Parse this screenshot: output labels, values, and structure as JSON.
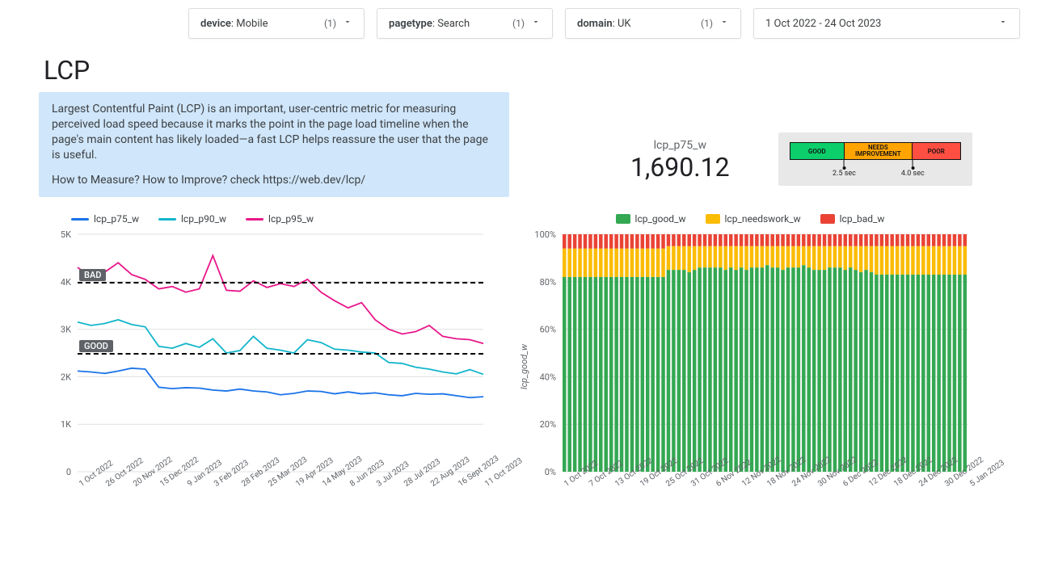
{
  "filters": [
    {
      "name": "device",
      "value": "Mobile",
      "count": "(1)"
    },
    {
      "name": "pagetype",
      "value": "Search",
      "count": "(1)"
    },
    {
      "name": "domain",
      "value": "UK",
      "count": "(1)"
    }
  ],
  "date_range": "1 Oct 2022 - 24 Oct 2023",
  "title": "LCP",
  "description": {
    "p1": "Largest Contentful Paint (LCP) is an important, user-centric metric for measuring perceived load speed because it marks the point in the page load timeline when the page's main content has likely loaded—a fast LCP helps reassure the user that the page is useful.",
    "p2": "How to Measure? How to Improve? check https://web.dev/lcp/"
  },
  "scorecard": {
    "label": "lcp_p75_w",
    "value": "1,690.12"
  },
  "thresholds": {
    "good": "GOOD",
    "ni": "NEEDS IMPROVEMENT",
    "poor": "POOR",
    "m1": "2.5 sec",
    "m2": "4.0 sec"
  },
  "chart_data": [
    {
      "id": "percentile_lines",
      "type": "line",
      "title": "",
      "ylabel": "",
      "ylim": [
        0,
        5000
      ],
      "yticks": [
        "0",
        "1K",
        "2K",
        "3K",
        "4K",
        "5K"
      ],
      "categories": [
        "1 Oct 2022",
        "26 Oct 2022",
        "20 Nov 2022",
        "15 Dec 2022",
        "9 Jan 2023",
        "3 Feb 2023",
        "28 Feb 2023",
        "25 Mar 2023",
        "19 Apr 2023",
        "14 May 2023",
        "8 Jun 2023",
        "3 Jul 2023",
        "28 Jul 2023",
        "22 Aug 2023",
        "16 Sept 2023",
        "11 Oct 2023"
      ],
      "annotations": {
        "bad_line": 4000,
        "good_line": 2500,
        "bad_label": "BAD",
        "good_label": "GOOD"
      },
      "series": [
        {
          "name": "lcp_p75_w",
          "color": "#1a73e8",
          "values": [
            2120,
            2100,
            2070,
            2120,
            2180,
            2160,
            1780,
            1750,
            1770,
            1760,
            1720,
            1700,
            1740,
            1700,
            1680,
            1620,
            1650,
            1700,
            1690,
            1640,
            1680,
            1640,
            1660,
            1620,
            1600,
            1650,
            1630,
            1640,
            1600,
            1560,
            1580
          ]
        },
        {
          "name": "lcp_p90_w",
          "color": "#12b5cb",
          "values": [
            3150,
            3080,
            3120,
            3200,
            3100,
            3050,
            2640,
            2600,
            2700,
            2620,
            2800,
            2500,
            2550,
            2850,
            2600,
            2560,
            2500,
            2780,
            2720,
            2580,
            2560,
            2520,
            2500,
            2300,
            2280,
            2200,
            2160,
            2100,
            2060,
            2150,
            2050
          ]
        },
        {
          "name": "lcp_p95_w",
          "color": "#e8178a",
          "values": [
            4300,
            4100,
            4200,
            4400,
            4150,
            4050,
            3850,
            3900,
            3780,
            3850,
            4550,
            3820,
            3800,
            4020,
            3880,
            3960,
            3900,
            4050,
            3780,
            3600,
            3450,
            3560,
            3200,
            3000,
            2900,
            2950,
            3080,
            2850,
            2800,
            2780,
            2700
          ]
        }
      ]
    },
    {
      "id": "stacked_pct",
      "type": "bar",
      "stacked": true,
      "ylabel": "lcp_good_w",
      "ylim": [
        0,
        100
      ],
      "yticks": [
        "0%",
        "20%",
        "40%",
        "60%",
        "80%",
        "100%"
      ],
      "categories": [
        "1 Oct 2022",
        "7 Oct 2022",
        "13 Oct 2022",
        "19 Oct 2022",
        "25 Oct 2022",
        "31 Oct 2022",
        "6 Nov 2022",
        "12 Nov 2022",
        "18 Nov 2022",
        "24 Nov 2022",
        "30 Nov 2022",
        "6 Dec 2022",
        "12 Dec 2022",
        "18 Dec 2022",
        "24 Dec 2022",
        "30 Dec 2022",
        "5 Jan 2023"
      ],
      "series": [
        {
          "name": "lcp_good_w",
          "color": "#34a853",
          "values": [
            82,
            82,
            82,
            82,
            82,
            82,
            82,
            82,
            82,
            82,
            82,
            82,
            82,
            82,
            82,
            82,
            82,
            82,
            82,
            82,
            85,
            85,
            85,
            85,
            84,
            85,
            86,
            86,
            86,
            86,
            86,
            85,
            86,
            85,
            86,
            85,
            86,
            86,
            86,
            87,
            86,
            86,
            85,
            86,
            86,
            86,
            87,
            86,
            85,
            85,
            85,
            86,
            86,
            86,
            85,
            86,
            85,
            84,
            85,
            84,
            83,
            83,
            83,
            83,
            83,
            83,
            83,
            83,
            83,
            83,
            83,
            83,
            83,
            83,
            83,
            83,
            83,
            83
          ]
        },
        {
          "name": "lcp_needswork_w",
          "color": "#fbbc04",
          "values": [
            12,
            12,
            12,
            12,
            12,
            12,
            12,
            12,
            12,
            12,
            12,
            12,
            12,
            12,
            12,
            12,
            12,
            12,
            12,
            12,
            10,
            10,
            10,
            10,
            11,
            10,
            9,
            9,
            9,
            9,
            9,
            10,
            9,
            10,
            9,
            10,
            9,
            9,
            9,
            8,
            9,
            9,
            10,
            9,
            9,
            9,
            8,
            9,
            10,
            10,
            10,
            9,
            9,
            9,
            10,
            9,
            10,
            11,
            10,
            11,
            12,
            12,
            12,
            12,
            12,
            12,
            12,
            12,
            12,
            12,
            12,
            12,
            12,
            12,
            12,
            12,
            12,
            12
          ]
        },
        {
          "name": "lcp_bad_w",
          "color": "#ea4335",
          "values": [
            6,
            6,
            6,
            6,
            6,
            6,
            6,
            6,
            6,
            6,
            6,
            6,
            6,
            6,
            6,
            6,
            6,
            6,
            6,
            6,
            5,
            5,
            5,
            5,
            5,
            5,
            5,
            5,
            5,
            5,
            5,
            5,
            5,
            5,
            5,
            5,
            5,
            5,
            5,
            5,
            5,
            5,
            5,
            5,
            5,
            5,
            5,
            5,
            5,
            5,
            5,
            5,
            5,
            5,
            5,
            5,
            5,
            5,
            5,
            5,
            5,
            5,
            5,
            5,
            5,
            5,
            5,
            5,
            5,
            5,
            5,
            5,
            5,
            5,
            5,
            5,
            5,
            5
          ]
        }
      ]
    }
  ]
}
